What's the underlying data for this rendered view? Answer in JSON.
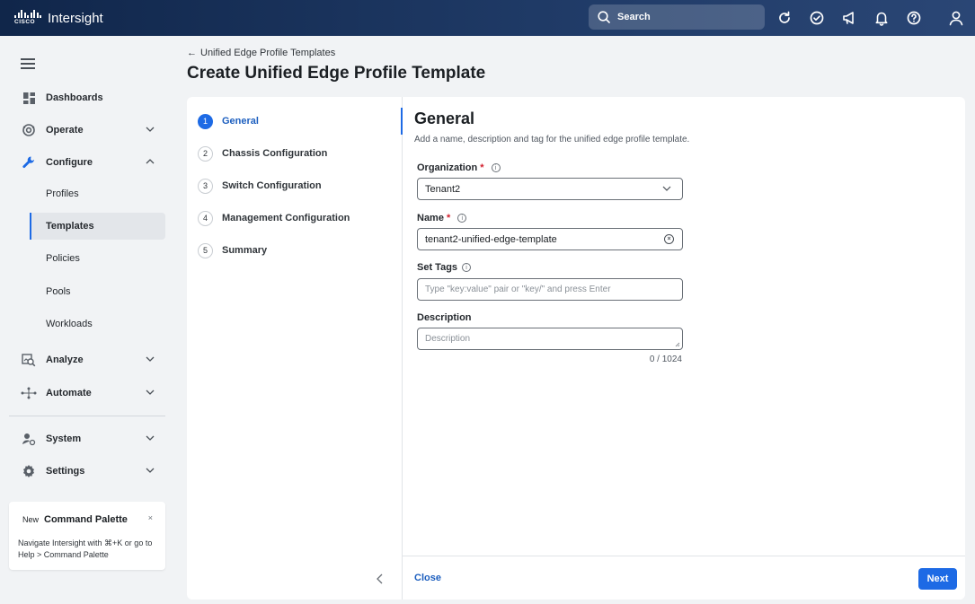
{
  "app": {
    "brand": "Intersight",
    "cisco_word": "CISCO"
  },
  "search": {
    "placeholder": "Search"
  },
  "topbar_icons": [
    "refresh-icon",
    "check-circle-icon",
    "megaphone-icon",
    "bell-icon",
    "help-icon",
    "user-icon"
  ],
  "sidebar": {
    "items": [
      {
        "label": "Dashboards",
        "icon": "dashboard-icon"
      },
      {
        "label": "Operate",
        "icon": "operate-icon"
      },
      {
        "label": "Configure",
        "icon": "wrench-icon"
      },
      {
        "label": "Analyze",
        "icon": "analyze-icon"
      },
      {
        "label": "Automate",
        "icon": "automate-icon"
      },
      {
        "label": "System",
        "icon": "system-icon"
      },
      {
        "label": "Settings",
        "icon": "settings-icon"
      }
    ],
    "configure_sub": [
      "Profiles",
      "Templates",
      "Policies",
      "Pools",
      "Workloads"
    ],
    "active_sub": "Templates"
  },
  "palette": {
    "new": "New",
    "title": "Command Palette",
    "close": "×",
    "body": "Navigate Intersight with ⌘+K or go to Help > Command Palette"
  },
  "breadcrumb": {
    "back": "Unified Edge Profile Templates"
  },
  "page": {
    "title": "Create Unified Edge Profile Template"
  },
  "steps": [
    {
      "num": "1",
      "label": "General"
    },
    {
      "num": "2",
      "label": "Chassis Configuration"
    },
    {
      "num": "3",
      "label": "Switch Configuration"
    },
    {
      "num": "4",
      "label": "Management Configuration"
    },
    {
      "num": "5",
      "label": "Summary"
    }
  ],
  "form": {
    "title": "General",
    "description": "Add a name, description and tag for the unified edge profile template.",
    "organization": {
      "label": "Organization",
      "required": "*",
      "value": "Tenant2"
    },
    "name": {
      "label": "Name",
      "required": "*",
      "value": "tenant2-unified-edge-template"
    },
    "tags": {
      "label": "Set Tags",
      "placeholder": "Type \"key:value\" pair or \"key/\" and press Enter"
    },
    "desc": {
      "label": "Description",
      "placeholder": "Description",
      "counter": "0 / 1024"
    }
  },
  "footer": {
    "close": "Close",
    "next": "Next"
  },
  "colors": {
    "accent": "#1d6ae5",
    "topbar": "#10264a",
    "required": "#d2202e"
  }
}
